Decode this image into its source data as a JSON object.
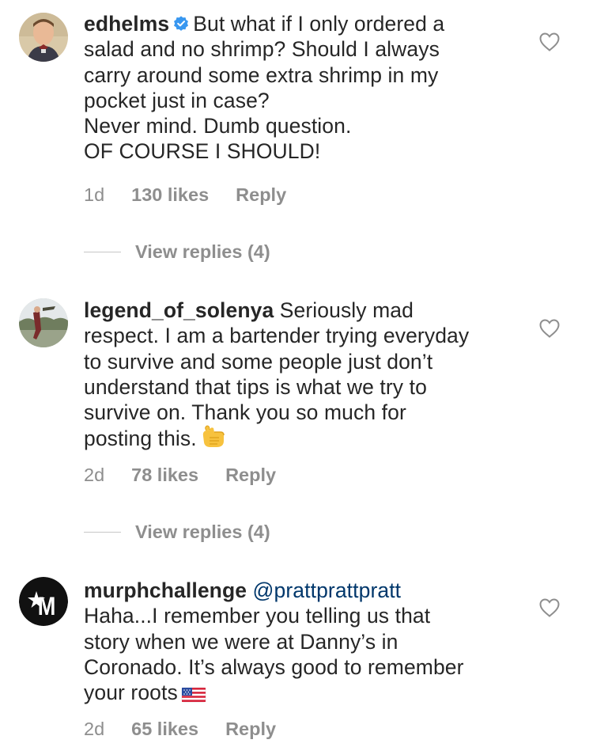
{
  "comments": [
    {
      "username": "edhelms",
      "verified": true,
      "lines": [
        "But what if I only ordered a",
        "salad and no shrimp? Should I always",
        "carry around some extra shrimp in my",
        "pocket just in case?",
        "Never mind. Dumb question.",
        "OF COURSE I SHOULD!"
      ],
      "time": "1d",
      "likes": "130 likes",
      "reply": "Reply",
      "view_replies": "View replies (4)",
      "avatar_icon": "profile-photo"
    },
    {
      "username": "legend_of_solenya",
      "lines": [
        "Seriously mad",
        "respect. I am a bartender trying everyday",
        "to survive and some people just don’t",
        "understand that tips is what we try to",
        "survive on. Thank you so much for",
        "posting this."
      ],
      "emoji": "call-me-hand-emoji",
      "time": "2d",
      "likes": "78 likes",
      "reply": "Reply",
      "view_replies": "View replies (4)",
      "avatar_icon": "profile-photo"
    },
    {
      "username": "murphchallenge",
      "mention": "@prattprattpratt",
      "lines": [
        "Haha...I remember you telling us that",
        "story when we were at Danny’s in",
        "Coronado. It’s always good to remember",
        "your roots"
      ],
      "emoji": "us-flag-emoji",
      "time": "2d",
      "likes": "65 likes",
      "reply": "Reply",
      "avatar_icon": "star-m-logo"
    }
  ],
  "colors": {
    "text": "#262626",
    "secondary": "#8e8e8e",
    "verified": "#3897f0",
    "mention": "#00376b"
  }
}
